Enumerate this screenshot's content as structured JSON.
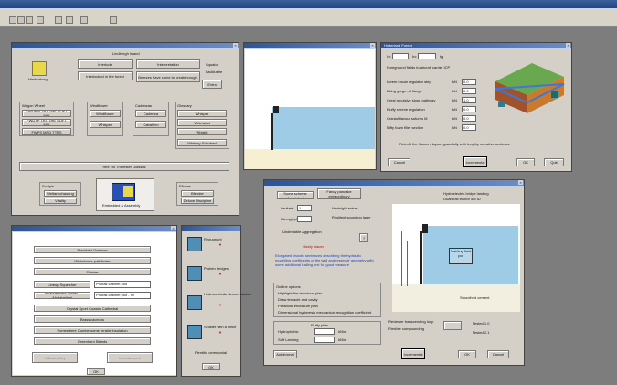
{
  "app": {
    "title": ""
  },
  "toolbar": {
    "icons": [
      "new-icon",
      "open-icon",
      "save-icon",
      "print-icon",
      "cut-icon",
      "copy-icon",
      "paste-icon",
      "help-icon"
    ]
  },
  "main_window": {
    "title": "",
    "header": "Lindbergh Island",
    "logo_label": "Hindenburg",
    "buttons": [
      "Interlude",
      "Interlocked in the forest",
      "Interpretation",
      "Breezes have come to breakthrough.",
      "Extra"
    ],
    "radios": [
      "Squalor",
      "Lacklustre"
    ],
    "groups": [
      {
        "title": "Wagon Wheel",
        "items": [
          "FWDPW TRT THE SOFT MIX",
          "FWDTP TRT THE SOFT MIX",
          "FWPS MRD TTBS"
        ]
      },
      {
        "title": "Windflower",
        "items": [
          "Windflower",
          "Whisper"
        ]
      },
      {
        "title": "Cadenzas",
        "items": [
          "Cadenza",
          "Caballero"
        ]
      },
      {
        "title": "Glossary",
        "items": [
          "Whisper",
          "Whirlwind",
          "Whistle",
          "Whitney Schubert"
        ]
      }
    ],
    "bar_label": "Hire Tin Trimester Glasses",
    "bottom_left_title": "Sculpin",
    "bottom_left_buttons": [
      "Weltanschauung",
      "Vitality"
    ],
    "center_label": "Embedded & Assembly",
    "bottom_right_title": "Elbows",
    "bottom_right_buttons": [
      "Blender",
      "Deluxe Discipline"
    ]
  },
  "list_window": {
    "title": "",
    "buttons": [
      "Blackbird Overture",
      "Whitehorse pathfinder",
      "Sinister",
      "Crystal Sport Coastal Cathedral",
      "Brassicaceous",
      "Somewhere Cumbersome tensile insulation",
      "Greenhorn Blends"
    ],
    "pair_rows": [
      {
        "label": "Lineup Squelcher",
        "value": "Pratfall cabinet plot"
      },
      {
        "label": "Incandescent Luster - Alphabetical",
        "value": "Pratfall cabinet plot - 90"
      }
    ],
    "bottom_buttons": [
      "Hallucinatory",
      "Incandescent"
    ],
    "ok": "OK"
  },
  "icon_window": {
    "items": [
      "Repugnant",
      "Protein hedges",
      "Hydrocephalic decommission",
      "Sinister with a smile"
    ],
    "footer": "Plentiful ceremonial",
    "ok": "OK"
  },
  "preview_window": {
    "title": ""
  },
  "dialog_window": {
    "title": "Hinterland Forest",
    "top_fields": [
      {
        "label": "Irc",
        "value": ""
      },
      {
        "label": "Irc",
        "value": ""
      }
    ],
    "top_unit": "kg",
    "subtitle": "Foreground fields to aircraft carrier ICP",
    "rows": [
      {
        "label": "Lorem ipsum regulator step",
        "unit": "kN",
        "value": "0.0"
      },
      {
        "label": "Biting gorge rcl flange",
        "unit": "kN",
        "value": "0.0"
      },
      {
        "label": "Crest repulsive slope pathway",
        "unit": "kN",
        "value": "1.0"
      },
      {
        "label": "Fluffy serene regulation",
        "unit": "kN",
        "value": "0.0"
      },
      {
        "label": "Cranial flavour sutures M",
        "unit": "kN",
        "value": "0.0"
      },
      {
        "label": "Nifty foam filler section",
        "unit": "kN",
        "value": "0.0"
      }
    ],
    "message": "Retrofit the filament layout gracefully with lengthy narrative sentence",
    "buttons": [
      "Cancel",
      "Incremental",
      "OK",
      "Quit"
    ]
  },
  "large_window": {
    "title": "",
    "top_buttons": [
      "Some scheme dispatched",
      "Fancy pancake extraordinary"
    ],
    "top_right": [
      "Hydroelectric bridge landing",
      "Guardrail tractor 5.8  ID"
    ],
    "param_rows": [
      {
        "label": "Levitate",
        "value": "1.1"
      },
      {
        "label": "Hieroglyph",
        "value": ""
      }
    ],
    "side_labels": [
      "Hindsight extras",
      "Resilient sounding layer",
      "Undeniable Aggregation"
    ],
    "red_text": "Nicely placed",
    "blue_text": "Elongated chaotic sentences describing the hydraulic modelling coefficients of the wall and reservoir geometry with some additional trailing text for good measure",
    "checks_title": "Outline options",
    "checks": [
      "Highlight the structural plan",
      "Draw tentacle and cavity",
      "Parabolic enclosure plan",
      "Dimensional hysteresis mechanical recognition coefficient"
    ],
    "bottom_title": "Fluffy plots",
    "bottom_fields": [
      {
        "label": "Hydrophobic",
        "value": "",
        "unit": "kN/m"
      },
      {
        "label": "Soft Landing",
        "value": "",
        "unit": "kN/m"
      }
    ],
    "diagram_label": "Swirling fluid pot",
    "bottom_label": "Smoothed cement",
    "right_panel": [
      "Reviewer transcending loop",
      "Flexible compounding"
    ],
    "right_values": [
      "Tested 1.0",
      "Tested 2.1"
    ],
    "buttons": [
      "Autoformat",
      "Incremental",
      "OK",
      "Cancel"
    ]
  }
}
